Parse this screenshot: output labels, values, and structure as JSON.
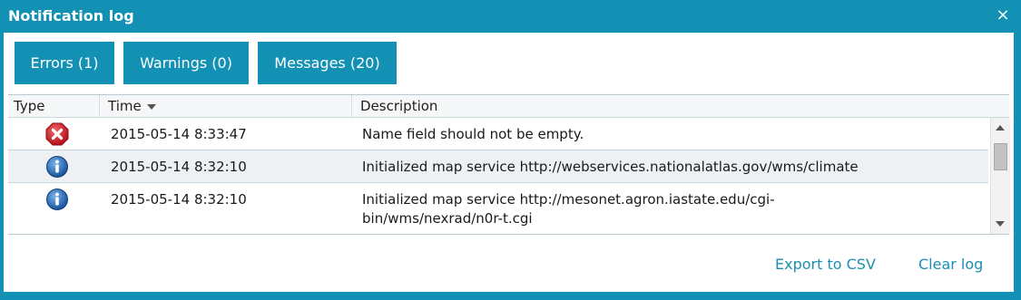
{
  "dialog": {
    "title": "Notification log",
    "close_glyph": "×"
  },
  "tabs": [
    {
      "label": "Errors (1)"
    },
    {
      "label": "Warnings (0)"
    },
    {
      "label": "Messages (20)"
    }
  ],
  "table": {
    "columns": {
      "type": "Type",
      "time": "Time",
      "description": "Description"
    },
    "sort": {
      "column": "time",
      "direction": "descending"
    },
    "rows": [
      {
        "type": "error",
        "time": "2015-05-14 8:33:47",
        "description_lines": [
          "Name field should not be empty."
        ]
      },
      {
        "type": "info",
        "time": "2015-05-14 8:32:10",
        "description_lines": [
          "Initialized map service http://webservices.nationalatlas.gov/wms/climate"
        ]
      },
      {
        "type": "info",
        "time": "2015-05-14 8:32:10",
        "description_lines": [
          "Initialized map service http://mesonet.agron.iastate.edu/cgi-",
          "bin/wms/nexrad/n0r-t.cgi"
        ]
      }
    ]
  },
  "actions": {
    "export": "Export to CSV",
    "clear": "Clear log"
  },
  "icons": {
    "error": "error-x-icon",
    "info": "info-icon",
    "close": "close-icon",
    "sort": "sort-desc-icon"
  },
  "colors": {
    "accent": "#1291b5",
    "link": "#1c8fb2",
    "error": "#c0262c",
    "info": "#1f5fa8"
  }
}
